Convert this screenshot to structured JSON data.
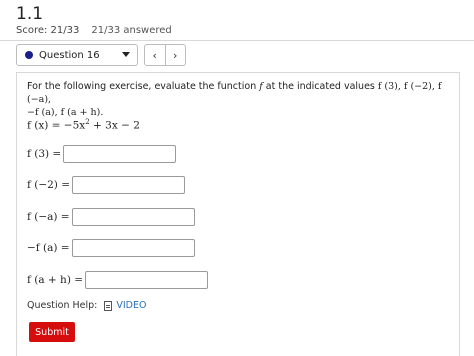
{
  "header": {
    "title": "1.1",
    "score": "Score: 21/33",
    "answered": "21/33 answered"
  },
  "question_nav": {
    "selected": "Question 16",
    "prev": "‹",
    "next": "›"
  },
  "question": {
    "prompt_prefix": "For the following exercise, evaluate the function ",
    "prompt_fn": "f",
    "prompt_middle": " at the indicated values ",
    "values_line1": "f (3), f (−2), f (−a),",
    "values_line2": "−f (a), f (a + h).",
    "function_def": "f (x) = −5x",
    "function_exp": "2",
    "function_rest": " + 3x − 2",
    "inputs": [
      {
        "label": "f (3) =",
        "value": ""
      },
      {
        "label": "f (−2) =",
        "value": ""
      },
      {
        "label": "f (−a) =",
        "value": ""
      },
      {
        "label": "−f (a) =",
        "value": ""
      },
      {
        "label": "f (a + h) =",
        "value": ""
      }
    ]
  },
  "help": {
    "label": "Question Help:",
    "video": "VIDEO"
  },
  "submit_label": "Submit",
  "colors": {
    "submit": "#d50d0d",
    "link": "#2a6fb3",
    "dot": "#1b1f8c"
  }
}
